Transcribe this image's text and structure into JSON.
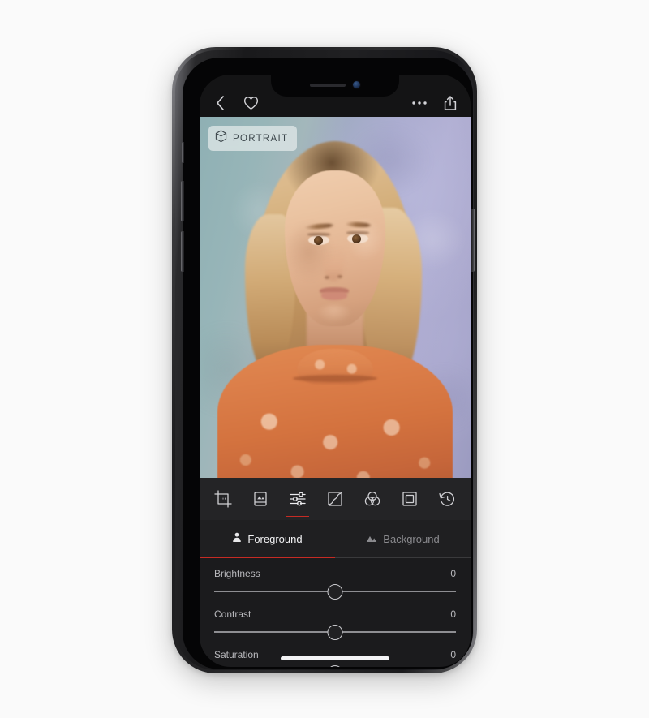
{
  "app": {
    "nav": {
      "back_icon": "chevron-left-icon",
      "favorite_icon": "heart-icon",
      "more_icon": "ellipsis-icon",
      "share_icon": "share-icon"
    },
    "photo": {
      "badge_label": "PORTRAIT",
      "badge_icon": "cube-icon",
      "subject": "woman in orange paisley turtleneck against teal-lavender wall"
    },
    "toolbar": {
      "tools": [
        {
          "name": "crop",
          "icon": "crop-icon",
          "active": false
        },
        {
          "name": "details",
          "icon": "details-icon",
          "active": false
        },
        {
          "name": "adjust",
          "icon": "sliders-icon",
          "active": true
        },
        {
          "name": "curves",
          "icon": "curves-icon",
          "active": false
        },
        {
          "name": "color-mixer",
          "icon": "color-wheels-icon",
          "active": false
        },
        {
          "name": "vignette",
          "icon": "vignette-icon",
          "active": false
        },
        {
          "name": "history",
          "icon": "history-icon",
          "active": false
        }
      ]
    },
    "segments": [
      {
        "label": "Foreground",
        "icon": "person-icon",
        "active": true
      },
      {
        "label": "Background",
        "icon": "mountain-icon",
        "active": false
      }
    ],
    "sliders": [
      {
        "label": "Brightness",
        "value": "0",
        "position": 50,
        "gradient": false
      },
      {
        "label": "Contrast",
        "value": "0",
        "position": 50,
        "gradient": false
      },
      {
        "label": "Saturation",
        "value": "0",
        "position": 50,
        "gradient": true
      }
    ],
    "colors": {
      "accent": "#c62b24",
      "panel_bg": "#1b1b1d",
      "toolbar_bg": "#242426",
      "nav_bg": "#141415",
      "text_primary": "#f2f2f4",
      "text_secondary": "#8a8a8e",
      "badge_bg": "#e2e9ea",
      "badge_text": "#3c464b"
    }
  }
}
